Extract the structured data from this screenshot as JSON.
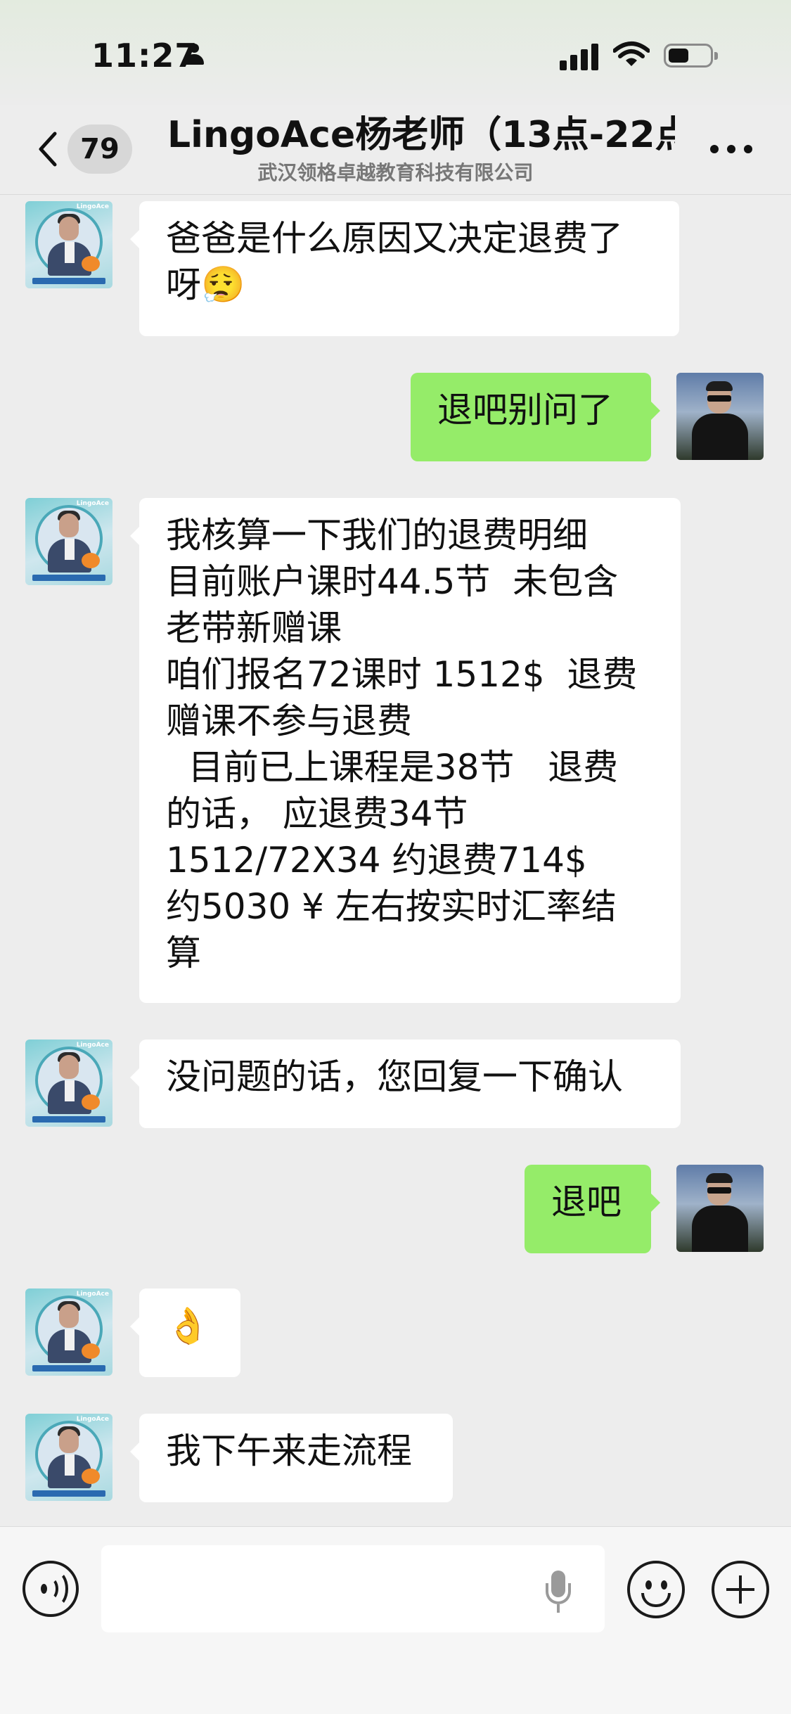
{
  "status_bar": {
    "time": "11:27"
  },
  "header": {
    "unread_count": "79",
    "title": "LingoAce杨老师（13点-22点",
    "subtitle": "武汉领格卓越教育科技有限公司"
  },
  "messages": [
    {
      "sender": "teacher",
      "text": "爸爸是什么原因又决定退费了\n呀😮‍💨"
    },
    {
      "sender": "me",
      "text": "退吧别问了"
    },
    {
      "sender": "teacher",
      "text": "我核算一下我们的退费明细\n目前账户课时44.5节  未包含\n老带新赠课\n咱们报名72课时 1512$  退费\n赠课不参与退费\n  目前已上课程是38节   退费\n的话， 应退费34节\n1512/72X34 约退费714$\n约5030 ¥ 左右按实时汇率结\n算"
    },
    {
      "sender": "teacher",
      "text": "没问题的话，您回复一下确认"
    },
    {
      "sender": "me",
      "text": "退吧"
    },
    {
      "sender": "teacher",
      "text": "👌"
    },
    {
      "sender": "teacher",
      "text": "我下午来走流程"
    }
  ],
  "avatars": {
    "teacher_brand": "LingoAce"
  },
  "input_bar": {
    "placeholder": ""
  },
  "colors": {
    "sent_bubble": "#95ec69",
    "received_bubble": "#ffffff",
    "background": "#ededed"
  }
}
